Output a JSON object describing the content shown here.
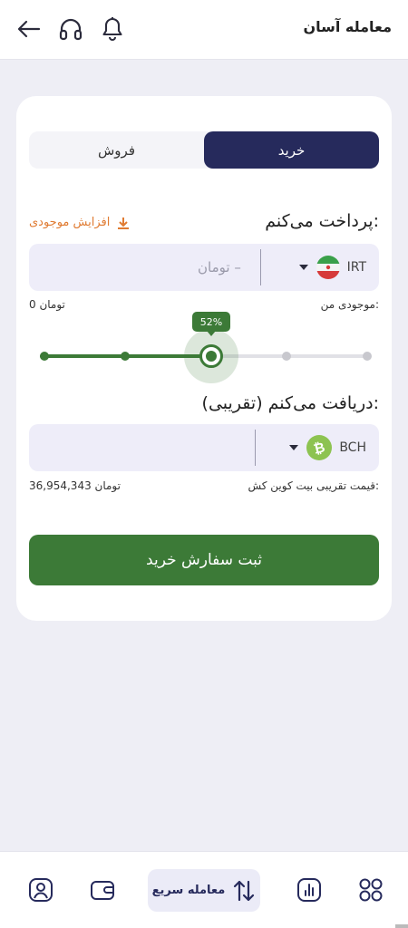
{
  "header": {
    "title": "معامله آسان"
  },
  "tabs": {
    "buy": "خرید",
    "sell": "فروش"
  },
  "pay": {
    "title": "پرداخت می‌کنم:",
    "add_funds": "افزایش موجودی",
    "currency": "IRT",
    "amount_placeholder": "– تومان"
  },
  "balance": {
    "label": "موجودی من:",
    "value": "0 تومان"
  },
  "slider": {
    "percent_label": "52%",
    "percent": 52
  },
  "receive": {
    "title": "دریافت می‌کنم (تقریبی):",
    "currency": "BCH"
  },
  "price": {
    "label": "قیمت تقریبی بیت کوین کش:",
    "value": "36,954,343 تومان"
  },
  "submit_label": "ثبت سفارش خرید",
  "bottom_nav": {
    "quick_trade": "معامله سریع"
  },
  "colors": {
    "primary": "#262a5c",
    "accent_green": "#3c7a37",
    "warning_orange": "#e07b32",
    "field_bg": "#eeedf9"
  }
}
